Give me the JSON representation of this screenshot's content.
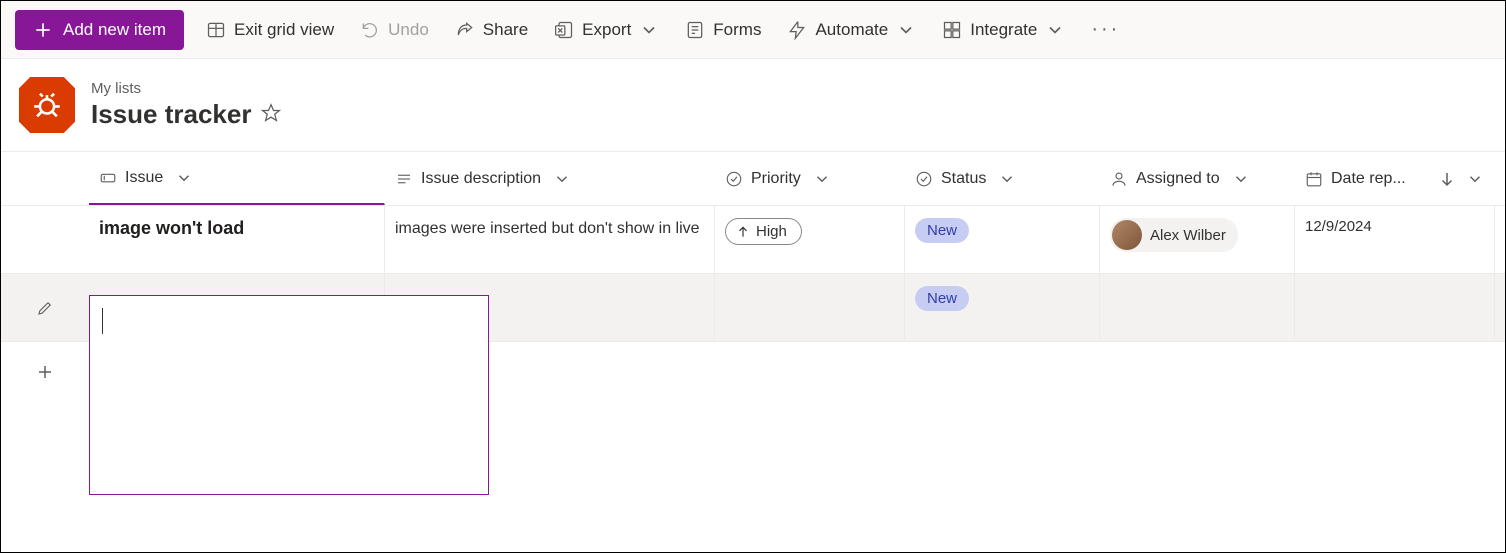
{
  "toolbar": {
    "add_label": "Add new item",
    "exit_grid": "Exit grid view",
    "undo": "Undo",
    "share": "Share",
    "export": "Export",
    "forms": "Forms",
    "automate": "Automate",
    "integrate": "Integrate"
  },
  "header": {
    "breadcrumb": "My lists",
    "title": "Issue tracker"
  },
  "columns": {
    "issue": "Issue",
    "description": "Issue description",
    "priority": "Priority",
    "status": "Status",
    "assigned": "Assigned to",
    "date": "Date rep..."
  },
  "rows": [
    {
      "issue": "image won't load",
      "description": "images were inserted but don't show in live",
      "priority": "High",
      "status": "New",
      "assigned": "Alex Wilber",
      "date": "12/9/2024"
    }
  ],
  "editing_row": {
    "status": "New"
  }
}
